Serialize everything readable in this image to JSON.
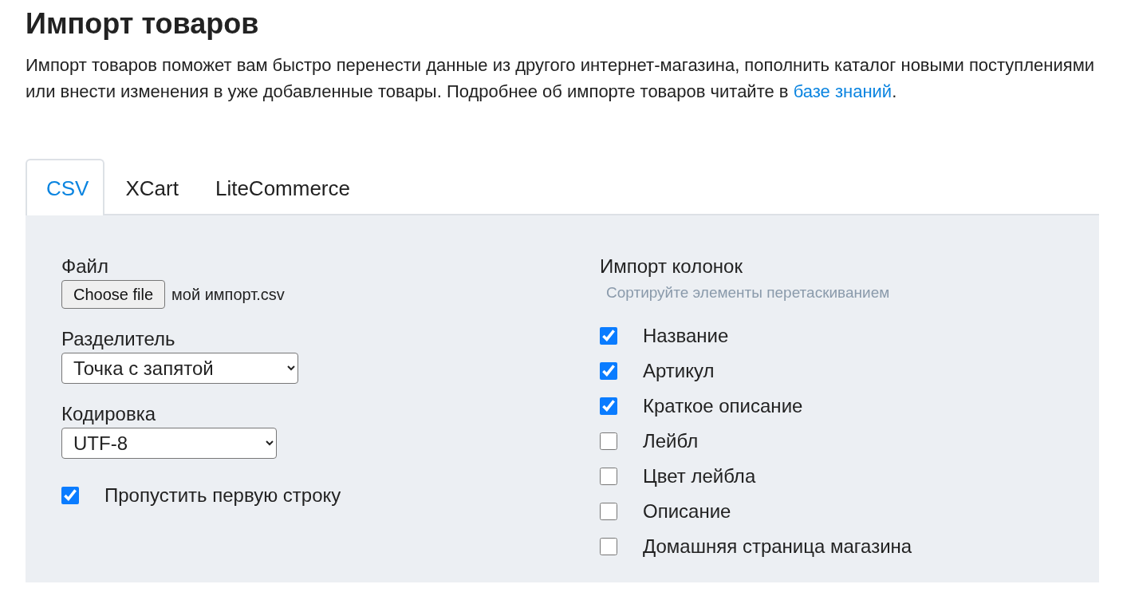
{
  "title": "Импорт товаров",
  "description": {
    "text": "Импорт товаров поможет вам быстро перенести данные из другого интернет-магазина, пополнить каталог новыми поступлениями или внести изменения в уже добавленные товары. Подробнее об импорте товаров читайте в ",
    "link": "базе знаний",
    "suffix": "."
  },
  "tabs": [
    {
      "label": "CSV",
      "selected": true
    },
    {
      "label": "XCart",
      "selected": false
    },
    {
      "label": "LiteCommerce",
      "selected": false
    }
  ],
  "file": {
    "label": "Файл",
    "button": "Choose file",
    "filename": "мой импорт.csv"
  },
  "separator": {
    "label": "Разделитель",
    "value": "Точка с запятой"
  },
  "encoding": {
    "label": "Кодировка",
    "value": "UTF-8"
  },
  "skip_first_row": {
    "label": "Пропустить первую строку",
    "checked": true
  },
  "columns": {
    "title": "Импорт колонок",
    "hint": "Сортируйте элементы перетаскиванием",
    "items": [
      {
        "label": "Название",
        "checked": true
      },
      {
        "label": "Артикул",
        "checked": true
      },
      {
        "label": "Краткое описание",
        "checked": true
      },
      {
        "label": "Лейбл",
        "checked": false
      },
      {
        "label": "Цвет лейбла",
        "checked": false
      },
      {
        "label": "Описание",
        "checked": false
      },
      {
        "label": "Домашняя страница магазина",
        "checked": false
      }
    ]
  }
}
